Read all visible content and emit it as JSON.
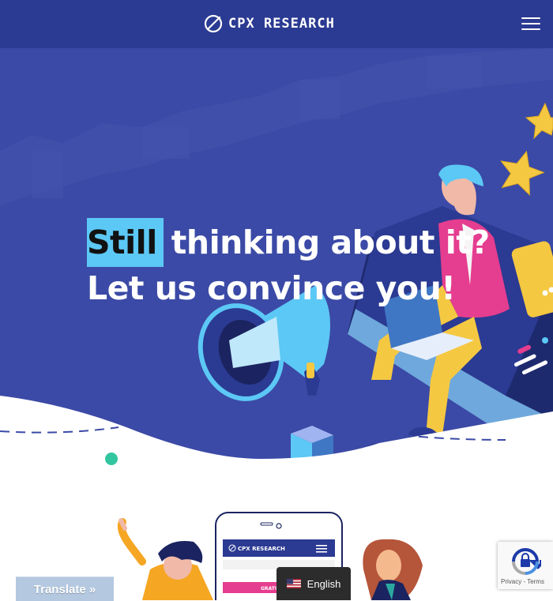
{
  "navbar": {
    "brand": "CPX RESEARCH",
    "logo_icon": "slashed-circle-icon",
    "menu_icon": "hamburger-menu-icon",
    "background": "#2b3a92"
  },
  "hero": {
    "highlight_word": "Still",
    "line1_rest": "thinking about it?",
    "line2": "Let us convince you!",
    "highlight_color": "#5cc8f5",
    "background": "#3b4aa6"
  },
  "phone_mockup": {
    "brand": "CPX RESEARCH",
    "button_text": "GRATU"
  },
  "translate_bar": {
    "label": "Translate »"
  },
  "language_switcher": {
    "label": "English",
    "flag_icon": "us-flag-icon"
  },
  "recaptcha": {
    "links": "Privacy - Terms",
    "icon": "recaptcha-icon"
  }
}
